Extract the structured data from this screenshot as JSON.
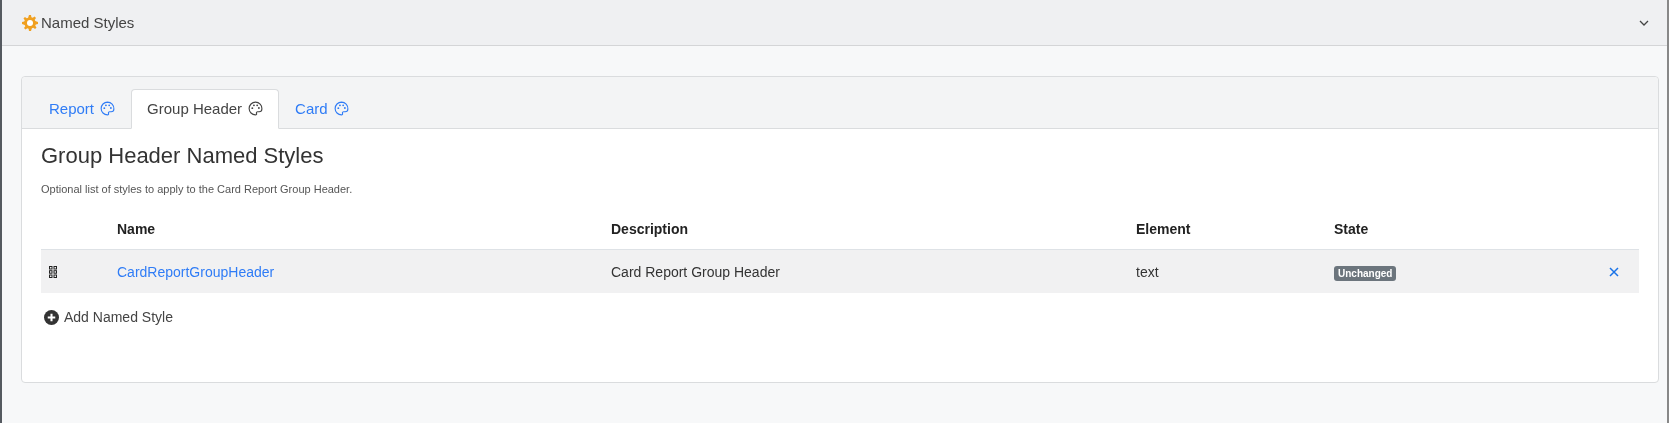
{
  "panel": {
    "title": "Named Styles",
    "expanded": true
  },
  "tabs": [
    {
      "label": "Report",
      "selected": false
    },
    {
      "label": "Group Header",
      "selected": true
    },
    {
      "label": "Card",
      "selected": false
    }
  ],
  "heading": "Group Header Named Styles",
  "description": "Optional list of styles to apply to the Card Report Group Header.",
  "table": {
    "columns": [
      "Name",
      "Description",
      "Element",
      "State"
    ],
    "rows": [
      {
        "name": "CardReportGroupHeader",
        "description": "Card Report Group Header",
        "element": "text",
        "state": "Unchanged"
      }
    ]
  },
  "add_button": "Add Named Style"
}
